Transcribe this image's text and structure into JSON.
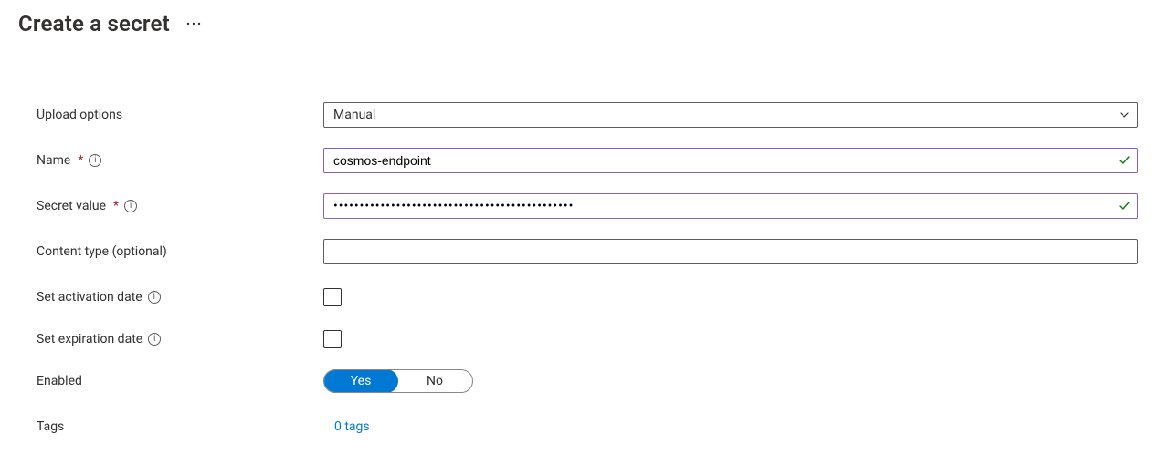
{
  "header": {
    "title": "Create a secret"
  },
  "form": {
    "upload_options": {
      "label": "Upload options",
      "value": "Manual"
    },
    "name": {
      "label": "Name",
      "value": "cosmos-endpoint",
      "valid": true
    },
    "secret_value": {
      "label": "Secret value",
      "value": "••••••••••••••••••••••••••••••••••••••••••••••",
      "valid": true
    },
    "content_type": {
      "label": "Content type (optional)",
      "value": ""
    },
    "activation_date": {
      "label": "Set activation date",
      "checked": false
    },
    "expiration_date": {
      "label": "Set expiration date",
      "checked": false
    },
    "enabled": {
      "label": "Enabled",
      "yes": "Yes",
      "no": "No",
      "value": "Yes"
    },
    "tags": {
      "label": "Tags",
      "link": "0 tags"
    }
  }
}
